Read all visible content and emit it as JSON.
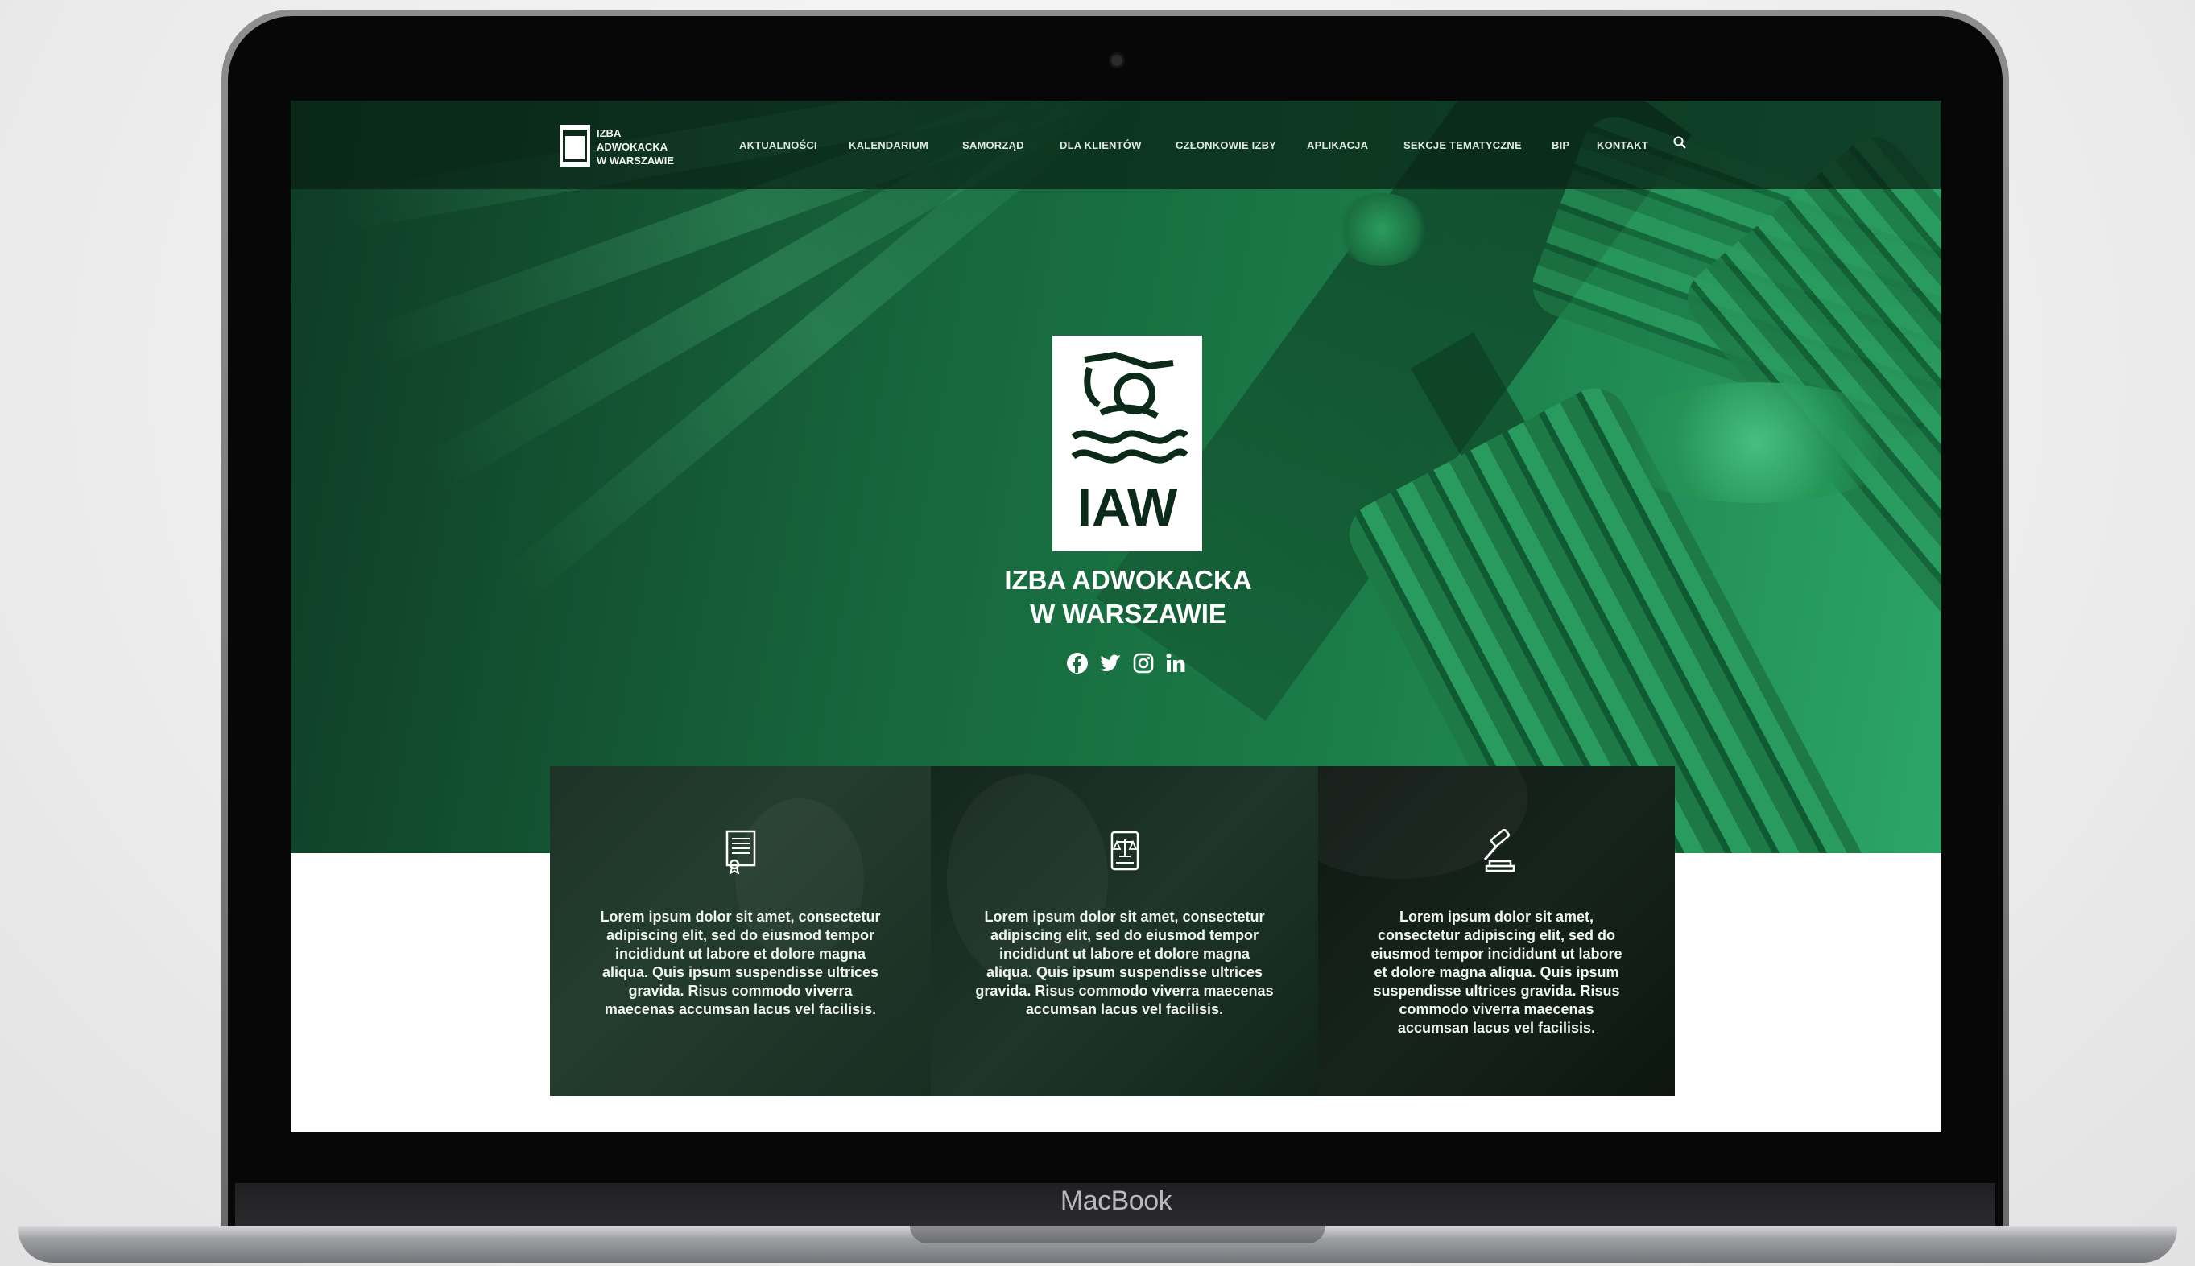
{
  "device": {
    "brand": "MacBook"
  },
  "nav": {
    "brand_lines": [
      "IZBA",
      "ADWOKACKA",
      "W WARSZAWIE"
    ],
    "items": [
      "AKTUALNOŚCI",
      "KALENDARIUM",
      "SAMORZĄD",
      "DLA KLIENTÓW",
      "CZŁONKOWIE IZBY",
      "APLIKACJA",
      "SEKCJE TEMATYCZNE",
      "BIP",
      "KONTAKT"
    ],
    "search_icon": "search-icon"
  },
  "hero": {
    "emblem_letters": "IAW",
    "title_lines": [
      "IZBA ADWOKACKA",
      "W WARSZAWIE"
    ],
    "social_icons": [
      "facebook-icon",
      "twitter-icon",
      "instagram-icon",
      "linkedin-icon"
    ]
  },
  "cards": [
    {
      "icon": "document-certificate-icon",
      "text": "Lorem ipsum dolor sit amet, consectetur adipiscing elit, sed do eiusmod tempor incididunt ut labore et dolore magna aliqua. Quis ipsum suspendisse ultrices gravida. Risus commodo viverra maecenas accumsan lacus vel facilisis."
    },
    {
      "icon": "law-book-scales-icon",
      "text": "Lorem ipsum dolor sit amet, consectetur adipiscing elit, sed do eiusmod tempor incididunt ut labore et dolore magna aliqua. Quis ipsum suspendisse ultrices gravida. Risus commodo viverra maecenas accumsan lacus vel facilisis."
    },
    {
      "icon": "gavel-icon",
      "text": "Lorem ipsum dolor sit amet, consectetur adipiscing elit, sed do eiusmod tempor incididunt ut labore et dolore magna aliqua. Quis ipsum suspendisse ultrices gravida. Risus commodo viverra maecenas accumsan lacus vel facilisis."
    }
  ],
  "colors": {
    "accent_green": "#1b7d49",
    "dark_green": "#0b2a1a",
    "card_dark": "#16241c"
  }
}
